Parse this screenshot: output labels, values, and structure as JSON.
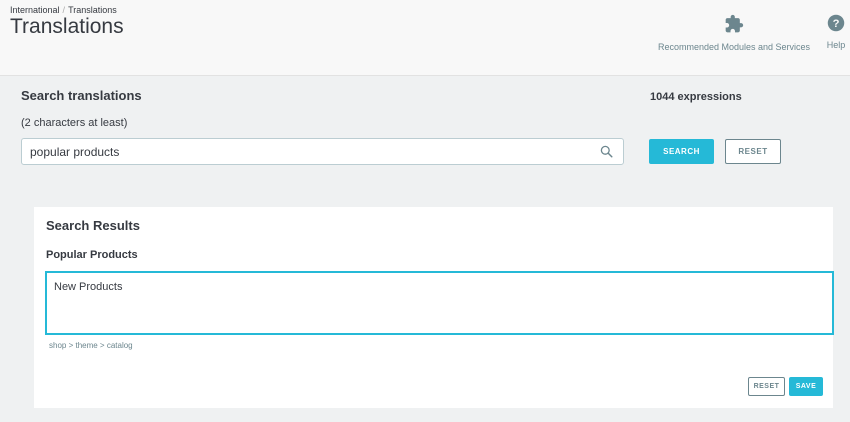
{
  "header": {
    "breadcrumb": [
      "International",
      "Translations"
    ],
    "title": "Translations",
    "toolbar": {
      "modules_label": "Recommended Modules and Services",
      "modules_icon": "puzzle-icon",
      "help_label": "Help",
      "help_icon": "help-icon"
    }
  },
  "search": {
    "title": "Search translations",
    "hint": "(2 characters at least)",
    "value": "popular products",
    "icon": "search-icon",
    "search_button": "Search",
    "reset_button": "Reset",
    "count": "1044 expressions"
  },
  "results": {
    "title": "Search Results",
    "label": "Popular Products",
    "translation_value": "New Products",
    "path": "shop > theme > catalog",
    "reset_button": "Reset",
    "save_button": "Save"
  },
  "colors": {
    "accent": "#25b9d7",
    "text": "#363a41",
    "muted": "#6c868e",
    "background": "#eff1f2"
  }
}
